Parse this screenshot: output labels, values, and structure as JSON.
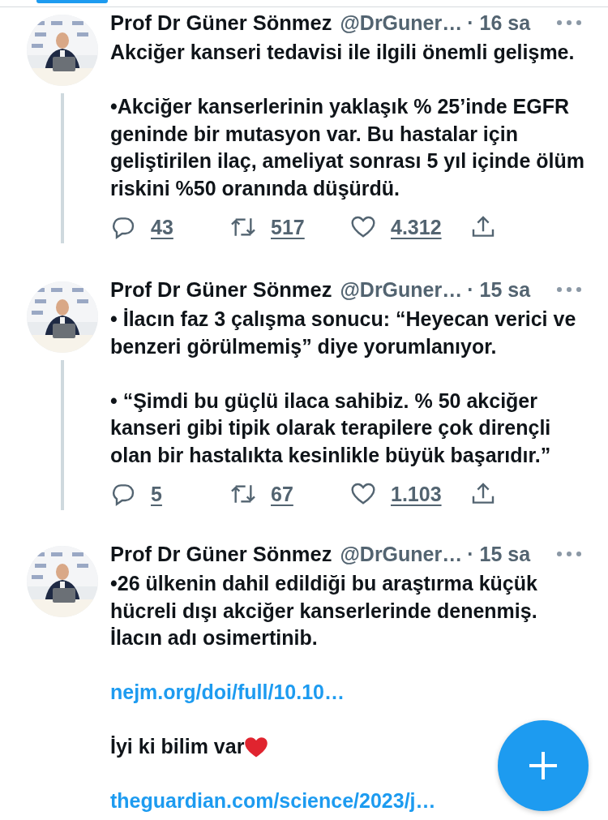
{
  "top_tab": {
    "selected": true
  },
  "tweets": [
    {
      "name": "Prof Dr Güner Sönmez",
      "handle": "@DrGuner…",
      "time": "· 16 sa",
      "thread_line": true,
      "body": [
        {
          "kind": "text",
          "text": "Akciğer kanseri tedavisi ile ilgili önemli gelişme."
        },
        {
          "kind": "text",
          "text": "•Akciğer kanserlerinin yaklaşık % 25’inde EGFR geninde bir mutasyon var. Bu hastalar için geliştirilen ilaç, ameliyat sonrası 5 yıl içinde ölüm riskini %50 oranında düşürdü."
        }
      ],
      "actions": {
        "replies": "43",
        "retweets": "517",
        "likes": "4.312"
      }
    },
    {
      "name": "Prof Dr Güner Sönmez",
      "handle": "@DrGuner…",
      "time": "· 15 sa",
      "thread_line": true,
      "body": [
        {
          "kind": "text",
          "text": "• İlacın faz 3 çalışma sonucu: “Heyecan verici ve benzeri görülmemiş” diye yorumlanıyor."
        },
        {
          "kind": "text",
          "text": "• “Şimdi bu güçlü ilaca sahibiz. % 50 akciğer kanseri gibi tipik olarak terapilere çok dirençli olan bir hastalıkta kesinlikle büyük başarıdır.”"
        }
      ],
      "actions": {
        "replies": "5",
        "retweets": "67",
        "likes": "1.103"
      }
    },
    {
      "name": "Prof Dr Güner Sönmez",
      "handle": "@DrGuner…",
      "time": "· 15 sa",
      "thread_line": false,
      "body": [
        {
          "kind": "text",
          "text": "•26 ülkenin dahil edildiği bu araştırma küçük hücreli dışı akciğer kanserlerinde denenmiş. İlacın adı osimertinib."
        },
        {
          "kind": "link",
          "text": "nejm.org/doi/full/10.10…"
        },
        {
          "kind": "text_heart",
          "text": "İyi ki bilim var"
        },
        {
          "kind": "link",
          "text": "theguardian.com/science/2023/j…"
        }
      ]
    }
  ]
}
